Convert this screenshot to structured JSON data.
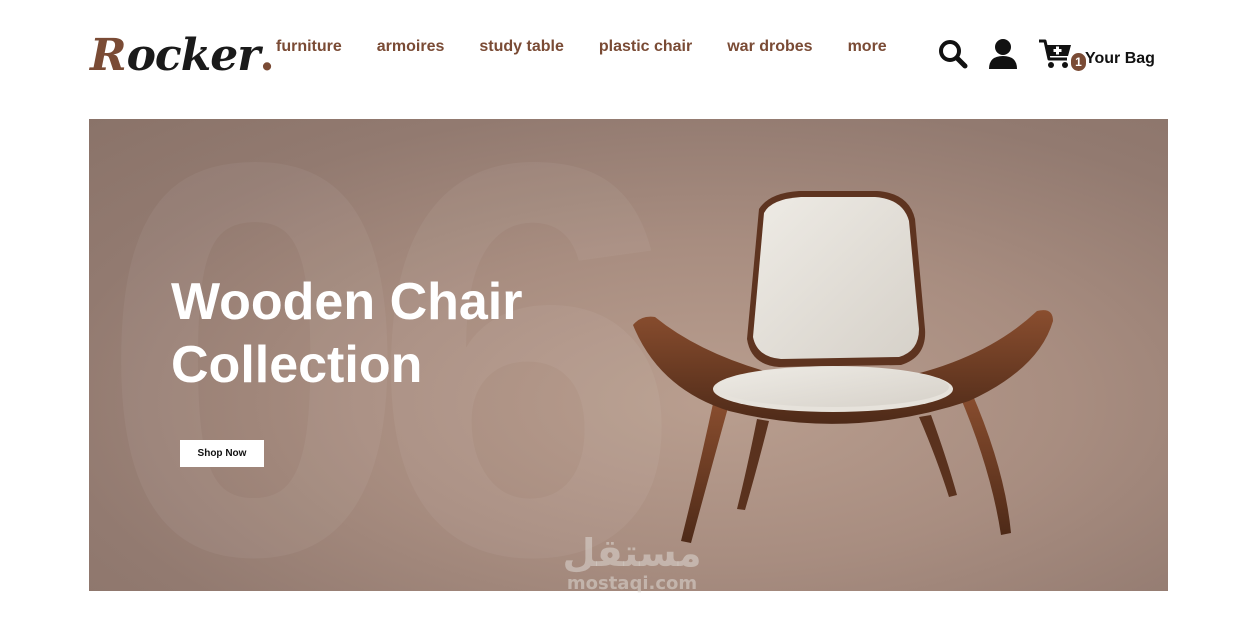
{
  "brand": {
    "logo_initial": "R",
    "logo_rest": "ocker",
    "logo_dot": "."
  },
  "nav": {
    "items": [
      {
        "label": "furniture"
      },
      {
        "label": "armoires"
      },
      {
        "label": "study table"
      },
      {
        "label": "plastic chair"
      },
      {
        "label": "war drobes"
      },
      {
        "label": "more"
      }
    ]
  },
  "actions": {
    "search_icon": "search-icon",
    "user_icon": "user-icon",
    "cart_icon": "cart-plus-icon",
    "cart_count": "1",
    "bag_label": "Your Bag"
  },
  "hero": {
    "title_line1": "Wooden Chair",
    "title_line2": "Collection",
    "button_label": "Shop Now",
    "background_number": "06"
  },
  "watermark": {
    "arabic": "مستقل",
    "latin": "mostaqi.com"
  },
  "colors": {
    "brand_brown": "#7a4b35",
    "hero_bg": "#a88d80",
    "text_dark": "#111111"
  }
}
